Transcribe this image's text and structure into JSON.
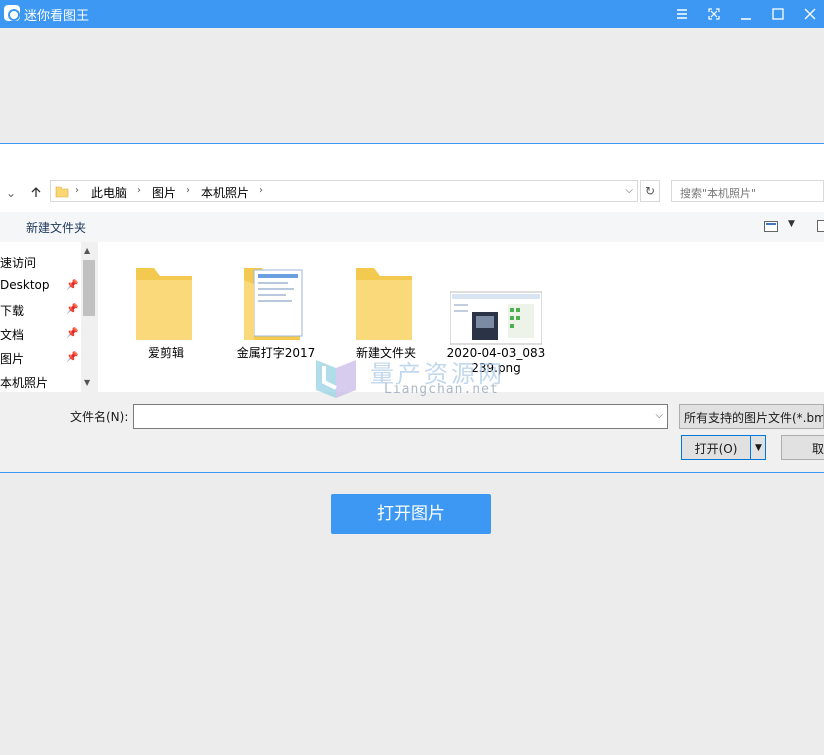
{
  "window": {
    "title": "迷你看图王",
    "controls": [
      "menu-icon",
      "fullscreen-icon",
      "minimize-icon",
      "maximize-icon",
      "close-icon"
    ],
    "accent": "#3d98f4"
  },
  "dialog": {
    "breadcrumbs": [
      "此电脑",
      "图片",
      "本机照片"
    ],
    "search_placeholder": "搜索\"本机照片\"",
    "toolbar": {
      "new_folder": "新建文件夹"
    },
    "nav_items": [
      {
        "label": "速访问",
        "pinned": false
      },
      {
        "label": "Desktop",
        "pinned": true
      },
      {
        "label": "下载",
        "pinned": true
      },
      {
        "label": "文档",
        "pinned": true
      },
      {
        "label": "图片",
        "pinned": true
      },
      {
        "label": "本机照片",
        "pinned": false
      }
    ],
    "files": [
      {
        "name": "爱剪辑",
        "type": "folder"
      },
      {
        "name": "金属打字2017",
        "type": "folder-with-content"
      },
      {
        "name": "新建文件夹",
        "type": "folder"
      },
      {
        "name": "2020-04-03_083239.png",
        "display": "2020-04-03_083 239.png",
        "type": "image"
      }
    ],
    "filename_label": "文件名(N):",
    "filename_value": "",
    "filter": "所有支持的图片文件(*.bmp",
    "open_button": "打开(O)",
    "cancel_button": "取"
  },
  "main": {
    "open_image_button": "打开图片"
  },
  "watermark": {
    "text_cn": "量产资源网",
    "text_en": "Liangchan.net"
  }
}
